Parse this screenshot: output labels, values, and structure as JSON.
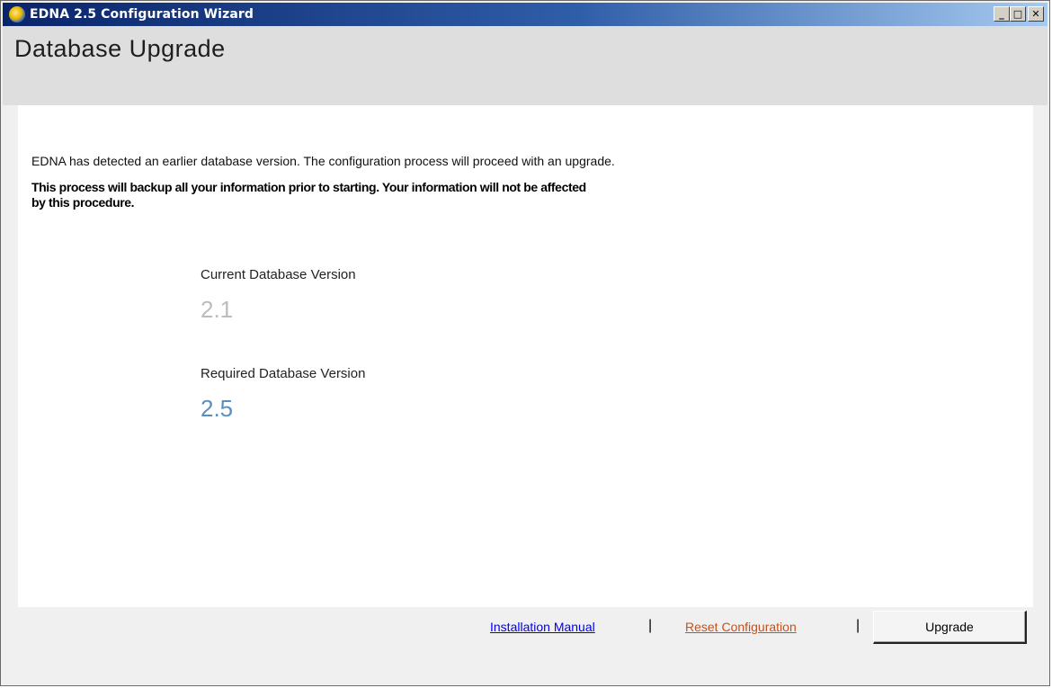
{
  "window": {
    "title": "EDNA 2.5 Configuration Wizard",
    "controls": {
      "minimize": "_",
      "maximize": "□",
      "close": "✕"
    }
  },
  "header": {
    "title": "Database Upgrade"
  },
  "main": {
    "detect_message": "EDNA has detected an earlier database version. The configuration process will proceed with an upgrade.",
    "backup_message": "This process will backup all your information prior to starting. Your information will not be affected by this procedure.",
    "current_version_label": "Current Database Version",
    "current_version_value": "2.1",
    "required_version_label": "Required Database Version",
    "required_version_value": "2.5"
  },
  "footer": {
    "manual_link": "Installation Manual",
    "separator": "|",
    "reset_link": "Reset Configuration",
    "upgrade_button": "Upgrade"
  },
  "colors": {
    "current_version": "#bcbcbc",
    "required_version": "#5a8fbf",
    "manual_link": "#0000ee",
    "reset_link": "#c8501a"
  },
  "icons": {
    "app_icon": "globe-icon"
  }
}
